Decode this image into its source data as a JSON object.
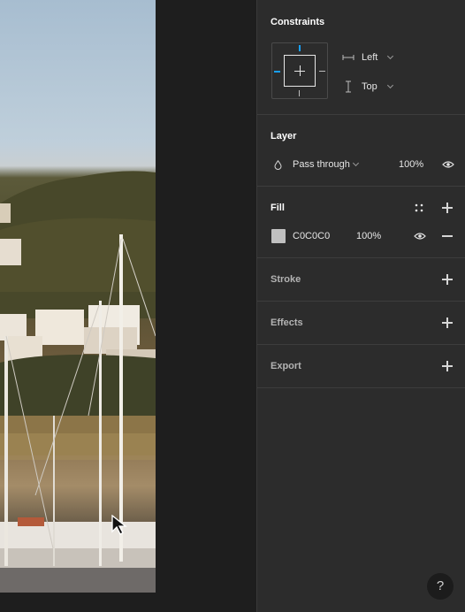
{
  "panel": {
    "constraints": {
      "title": "Constraints",
      "horizontal": "Left",
      "vertical": "Top"
    },
    "layer": {
      "title": "Layer",
      "blend_mode": "Pass through",
      "opacity": "100%"
    },
    "fill": {
      "title": "Fill",
      "hex": "C0C0C0",
      "opacity": "100%",
      "swatch_color": "#c0c0c0"
    },
    "stroke": {
      "title": "Stroke"
    },
    "effects": {
      "title": "Effects"
    },
    "export": {
      "title": "Export"
    }
  },
  "help": {
    "label": "?"
  },
  "colors": {
    "accent": "#18a0fb",
    "panel_bg": "#2c2c2c",
    "canvas_bg": "#1e1e1e"
  }
}
